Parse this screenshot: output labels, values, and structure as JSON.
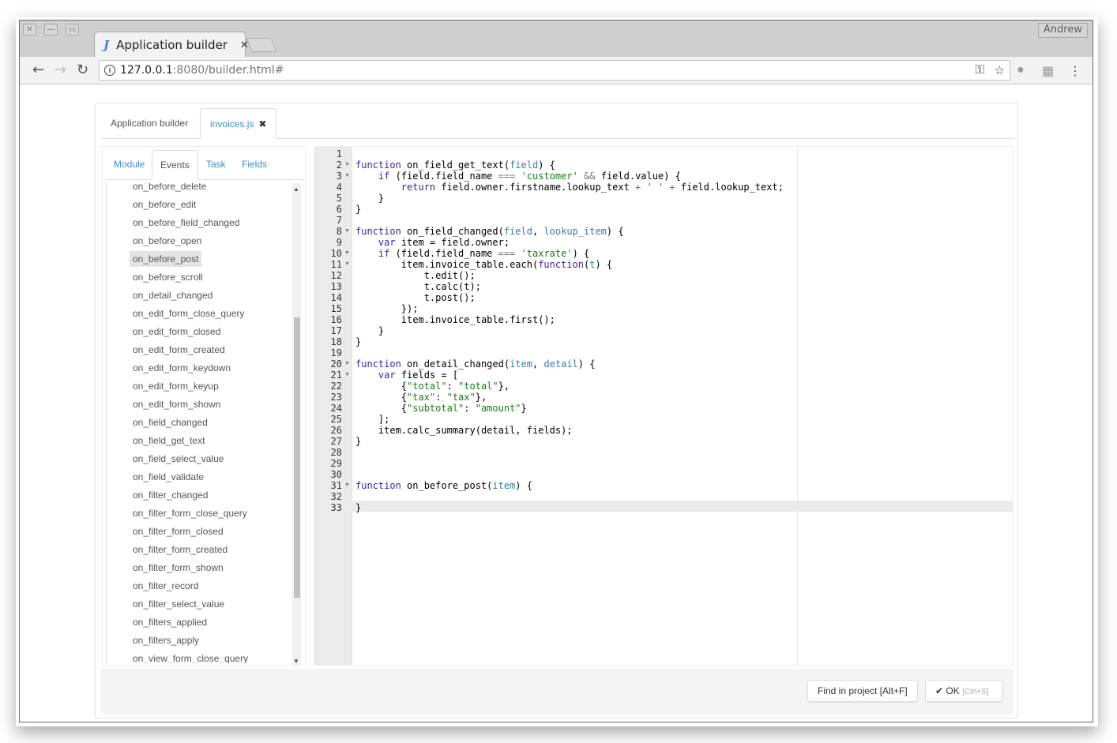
{
  "browser": {
    "window_buttons": [
      "close",
      "minimize",
      "maximize"
    ],
    "user": "Andrew",
    "tab": {
      "title": "Application builder",
      "favicon": "J"
    },
    "url": {
      "host": "127.0.0.1",
      "rest": ":8080/builder.html#"
    }
  },
  "app": {
    "tabs": [
      {
        "label": "Application builder",
        "active": false
      },
      {
        "label": "invoices.js",
        "active": true,
        "closable": true
      }
    ],
    "sub_tabs": [
      {
        "label": "Module",
        "active": false
      },
      {
        "label": "Events",
        "active": true
      },
      {
        "label": "Task",
        "active": false
      },
      {
        "label": "Fields",
        "active": false
      }
    ],
    "events": [
      "on_before_delete",
      "on_before_edit",
      "on_before_field_changed",
      "on_before_open",
      "on_before_post",
      "on_before_scroll",
      "on_detail_changed",
      "on_edit_form_close_query",
      "on_edit_form_closed",
      "on_edit_form_created",
      "on_edit_form_keydown",
      "on_edit_form_keyup",
      "on_edit_form_shown",
      "on_field_changed",
      "on_field_get_text",
      "on_field_select_value",
      "on_field_validate",
      "on_filter_changed",
      "on_filter_form_close_query",
      "on_filter_form_closed",
      "on_filter_form_created",
      "on_filter_form_shown",
      "on_filter_record",
      "on_filter_select_value",
      "on_filters_applied",
      "on_filters_apply",
      "on_view_form_close_query"
    ],
    "selected_event": "on_before_post",
    "editor": {
      "active_line": 33,
      "fold_lines": [
        2,
        3,
        8,
        10,
        11,
        20,
        21,
        31
      ],
      "lines": [
        "",
        "function on_field_get_text(field) {",
        "    if (field.field_name === 'customer' && field.value) {",
        "        return field.owner.firstname.lookup_text + ' ' + field.lookup_text;",
        "    }",
        "}",
        "",
        "function on_field_changed(field, lookup_item) {",
        "    var item = field.owner;",
        "    if (field.field_name === 'taxrate') {",
        "        item.invoice_table.each(function(t) {",
        "            t.edit();",
        "            t.calc(t);",
        "            t.post();",
        "        });",
        "        item.invoice_table.first();",
        "    }",
        "}",
        "",
        "function on_detail_changed(item, detail) {",
        "    var fields = [",
        "        {\"total\": \"total\"},",
        "        {\"tax\": \"tax\"},",
        "        {\"subtotal\": \"amount\"}",
        "    ];",
        "    item.calc_summary(detail, fields);",
        "}",
        "",
        "",
        "",
        "function on_before_post(item) {",
        "",
        "}"
      ]
    },
    "footer": {
      "find_label": "Find in project [Alt+F]",
      "ok_label": "OK",
      "ok_hint": "[Ctrl+S]"
    }
  }
}
